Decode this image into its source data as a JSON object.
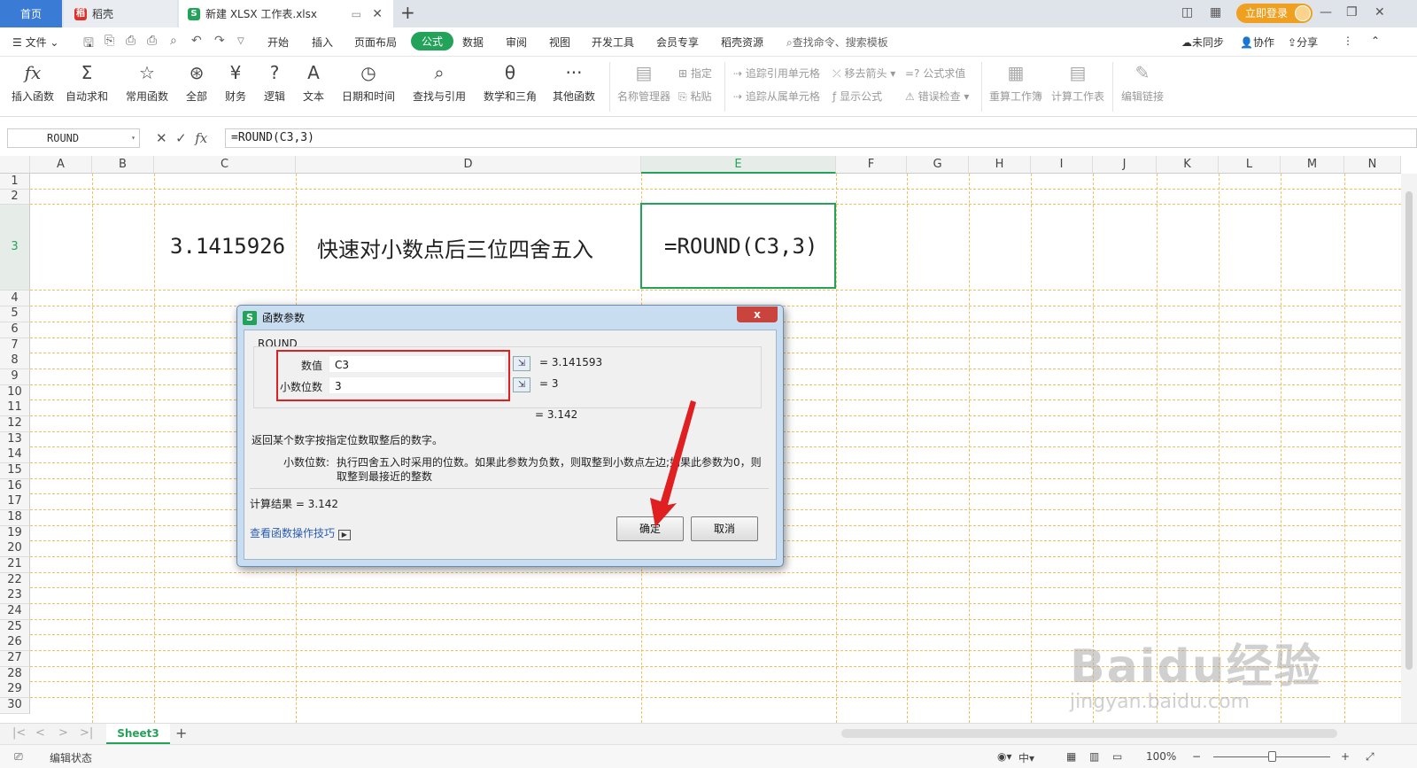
{
  "titlebar": {
    "home_tab": "首页",
    "daoke_tab": "稻壳",
    "file_tab": "新建 XLSX 工作表.xlsx",
    "login_button": "立即登录"
  },
  "menubar": {
    "file": "文件",
    "items": [
      "开始",
      "插入",
      "页面布局",
      "公式",
      "数据",
      "审阅",
      "视图",
      "开发工具",
      "会员专享",
      "稻壳资源"
    ],
    "active_item": "公式",
    "search": "查找命令、搜索模板",
    "sync": "未同步",
    "collab": "协作",
    "share": "分享"
  },
  "ribbon": {
    "insert_function": "插入函数",
    "autosum": "自动求和",
    "common_functions": "常用函数",
    "all": "全部",
    "finance": "财务",
    "logic": "逻辑",
    "text": "文本",
    "datetime": "日期和时间",
    "lookup": "查找与引用",
    "math": "数学和三角",
    "other": "其他函数",
    "name_manager": "名称管理器",
    "define": "指定",
    "paste": "粘贴",
    "trace_precedents": "追踪引用单元格",
    "trace_dependents": "追踪从属单元格",
    "remove_arrows": "移去箭头",
    "show_formulas": "显示公式",
    "eval_formula": "公式求值",
    "error_check": "错误检查",
    "recalc_workbook": "重算工作簿",
    "calc_sheet": "计算工作表",
    "edit_links": "编辑链接"
  },
  "formula_bar": {
    "name_box": "ROUND",
    "formula": "=ROUND(C3,3)"
  },
  "grid": {
    "columns": [
      "A",
      "B",
      "C",
      "D",
      "E",
      "F",
      "G",
      "H",
      "I",
      "J",
      "K",
      "L",
      "M",
      "N"
    ],
    "selected_column": "E",
    "rows": [
      "1",
      "2",
      "3",
      "4",
      "5",
      "6",
      "7",
      "8",
      "9",
      "10",
      "11",
      "12",
      "13",
      "14",
      "15",
      "16",
      "17",
      "18",
      "19",
      "20",
      "21",
      "22",
      "23",
      "24",
      "25",
      "26",
      "27",
      "28",
      "29",
      "30"
    ],
    "selected_row": "3",
    "cell_c3": "3.1415926",
    "cell_d3": "快速对小数点后三位四舍五入",
    "cell_e3": "=ROUND(C3,3)"
  },
  "dialog": {
    "title": "函数参数",
    "close": "x",
    "function_name": "ROUND",
    "arg1_label": "数值",
    "arg1_value": "C3",
    "arg1_result": "= 3.141593",
    "arg2_label": "小数位数",
    "arg2_value": "3",
    "arg2_result": "= 3",
    "overall_result": "= 3.142",
    "description": "返回某个数字按指定位数取整后的数字。",
    "param_label": "小数位数:",
    "param_desc_line1": "执行四舍五入时采用的位数。如果此参数为负数，则取整到小数点左边;如果此参数为0，则",
    "param_desc_line2": "取整到最接近的整数",
    "calc_result": "计算结果 = 3.142",
    "help_link": "查看函数操作技巧",
    "ok_button": "确定",
    "cancel_button": "取消"
  },
  "sheetbar": {
    "sheet_name": "Sheet3",
    "add": "+"
  },
  "statusbar": {
    "mode": "编辑状态",
    "zoom": "100%"
  },
  "watermark": {
    "main": "Baidu经验",
    "sub": "jingyan.baidu.com"
  }
}
